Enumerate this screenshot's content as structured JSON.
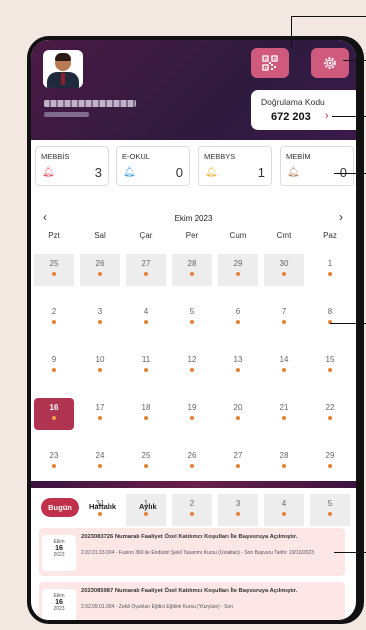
{
  "header": {
    "verification": {
      "label": "Doğrulama Kodu",
      "code": "672 203",
      "arrow": "›"
    },
    "qr_icon": "qr-icon",
    "settings_icon": "gear-icon"
  },
  "cards": [
    {
      "title": "MEBBİS",
      "count": "3",
      "bell_color": "#e35766"
    },
    {
      "title": "E-OKUL",
      "count": "0",
      "bell_color": "#4aa3e8"
    },
    {
      "title": "MEBBYS",
      "count": "1",
      "bell_color": "#f2b441"
    },
    {
      "title": "MEBİM",
      "count": "0",
      "bell_color": "#b88967"
    }
  ],
  "calendar": {
    "prev": "‹",
    "next": "›",
    "month": "Ekim 2023",
    "weekdays": [
      "Pzt",
      "Sal",
      "Çar",
      "Per",
      "Cum",
      "Cmt",
      "Paz"
    ],
    "weeks": [
      [
        {
          "day": "25",
          "muted": true
        },
        {
          "day": "26",
          "muted": true
        },
        {
          "day": "27",
          "muted": true
        },
        {
          "day": "28",
          "muted": true
        },
        {
          "day": "29",
          "muted": true
        },
        {
          "day": "30",
          "muted": true
        },
        {
          "day": "1",
          "muted": false
        }
      ],
      [
        {
          "day": "2",
          "muted": false
        },
        {
          "day": "3",
          "muted": false
        },
        {
          "day": "4",
          "muted": false
        },
        {
          "day": "5",
          "muted": false
        },
        {
          "day": "6",
          "muted": false
        },
        {
          "day": "7",
          "muted": false
        },
        {
          "day": "8",
          "muted": false
        }
      ],
      [
        {
          "day": "9",
          "muted": false
        },
        {
          "day": "10",
          "muted": false
        },
        {
          "day": "11",
          "muted": false
        },
        {
          "day": "12",
          "muted": false
        },
        {
          "day": "13",
          "muted": false
        },
        {
          "day": "14",
          "muted": false
        },
        {
          "day": "15",
          "muted": false
        }
      ],
      [
        {
          "day": "16",
          "muted": false,
          "today": true
        },
        {
          "day": "17",
          "muted": false
        },
        {
          "day": "18",
          "muted": false
        },
        {
          "day": "19",
          "muted": false
        },
        {
          "day": "20",
          "muted": false
        },
        {
          "day": "21",
          "muted": false
        },
        {
          "day": "22",
          "muted": false
        }
      ],
      [
        {
          "day": "23",
          "muted": false
        },
        {
          "day": "24",
          "muted": false
        },
        {
          "day": "25",
          "muted": false
        },
        {
          "day": "26",
          "muted": false
        },
        {
          "day": "27",
          "muted": false
        },
        {
          "day": "28",
          "muted": false
        },
        {
          "day": "29",
          "muted": false
        }
      ],
      [
        {
          "day": "30",
          "muted": false
        },
        {
          "day": "31",
          "muted": false
        },
        {
          "day": "1",
          "muted": true
        },
        {
          "day": "2",
          "muted": true
        },
        {
          "day": "3",
          "muted": true
        },
        {
          "day": "4",
          "muted": true
        },
        {
          "day": "5",
          "muted": true
        }
      ]
    ]
  },
  "tabs": {
    "today": "Bugün",
    "weekly": "Haftalık",
    "monthly": "Aylık"
  },
  "events": [
    {
      "month": "Ekim",
      "day": "16",
      "year": "2023",
      "title": "2023083726 Numaralı Faaliyet Özel Katılımcı Koşulları İle Başvuruya Açılmıştır.",
      "desc": "2.02.01.03.004 - Fusion 360 ile Endüstri Şekil Tasarımı Kursu (Uzaktan) - Son Başvuru Tarihi: 19/10/2023"
    },
    {
      "month": "Ekim",
      "day": "16",
      "year": "2023",
      "title": "2023085987 Numaralı Faaliyet Özel Katılımcı Koşulları İle Başvuruya Açılmıştır.",
      "desc": "2.02.09.01.004 - Zekâ Oyunları Eğitici Eğitimi Kursu (Yüzyüze) - Son"
    }
  ]
}
